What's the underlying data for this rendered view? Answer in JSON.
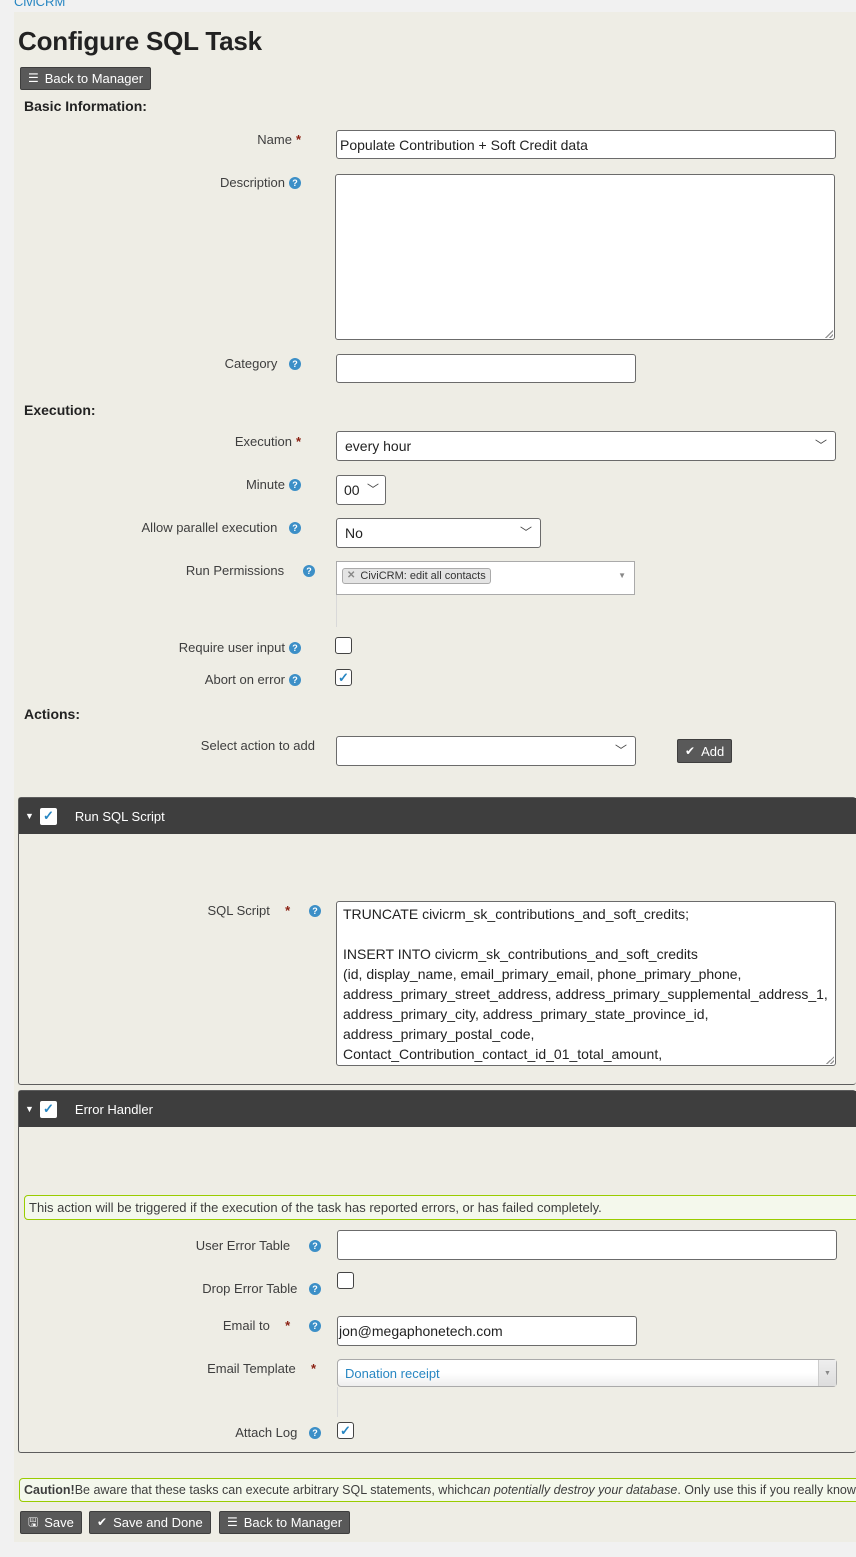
{
  "breadcrumb": "CiviCRM",
  "page_title": "Configure SQL Task",
  "buttons": {
    "back_to_manager": "Back to Manager",
    "add": "Add",
    "save": "Save",
    "save_and_done": "Save and Done"
  },
  "sections": {
    "basic": "Basic Information:",
    "execution": "Execution:",
    "actions": "Actions:"
  },
  "fields": {
    "name": {
      "label": "Name",
      "value": "Populate Contribution + Soft Credit data",
      "required": true
    },
    "description": {
      "label": "Description",
      "value": ""
    },
    "category": {
      "label": "Category",
      "value": ""
    },
    "execution": {
      "label": "Execution",
      "value": "every hour",
      "required": true
    },
    "minute": {
      "label": "Minute",
      "value": "00"
    },
    "parallel": {
      "label": "Allow parallel execution",
      "value": "No"
    },
    "run_permissions": {
      "label": "Run Permissions",
      "tags": [
        "CiviCRM: edit all contacts"
      ]
    },
    "require_input": {
      "label": "Require user input",
      "checked": false
    },
    "abort_on_error": {
      "label": "Abort on error",
      "checked": true
    },
    "select_action": {
      "label": "Select action to add",
      "value": ""
    }
  },
  "actions": [
    {
      "title": "Run SQL Script",
      "enabled": true,
      "sql_label": "SQL Script",
      "sql_lines": "TRUNCATE civicrm_sk_contributions_and_soft_credits;\n\nINSERT INTO civicrm_sk_contributions_and_soft_credits\n(id, display_name, email_primary_email, phone_primary_phone,\naddress_primary_street_address, address_primary_supplemental_address_1,\naddress_primary_city, address_primary_state_province_id,\naddress_primary_postal_code,\nContact_Contribution_contact_id_01_total_amount,"
    },
    {
      "title": "Error Handler",
      "enabled": true,
      "help": "This action will be triggered if the execution of the task has reported errors, or has failed completely.",
      "user_error_table": {
        "label": "User Error Table",
        "value": ""
      },
      "drop_error_table": {
        "label": "Drop Error Table",
        "checked": false
      },
      "email_to": {
        "label": "Email to",
        "value": "jon@megaphonetech.com"
      },
      "email_template": {
        "label": "Email Template",
        "value": "Donation receipt"
      },
      "attach_log": {
        "label": "Attach Log",
        "checked": true
      }
    }
  ],
  "caution": {
    "strong": "Caution!",
    "text1": " Be aware that these tasks can execute arbitrary SQL statements, which ",
    "em": "can potentially destroy your database",
    "text2": ". Only use this if you really know what you're doing"
  },
  "colors": {
    "accent": "#2786c2",
    "panel_header": "#3e3e3e",
    "page_bg": "#eeede5",
    "required": "#8a1f11"
  }
}
